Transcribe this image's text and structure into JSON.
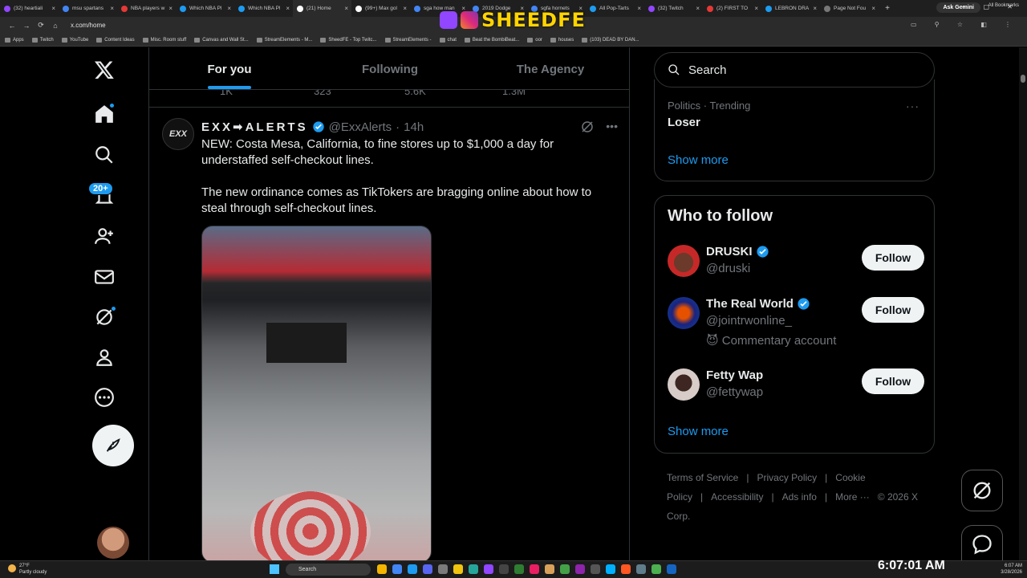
{
  "browser": {
    "tabs": [
      {
        "label": "(32) heartiali",
        "color": "#9146ff"
      },
      {
        "label": "msu spartans",
        "color": "#4285f4"
      },
      {
        "label": "NBA players w",
        "color": "#e53935"
      },
      {
        "label": "Which NBA Pl",
        "color": "#1d9bf0"
      },
      {
        "label": "Which NBA Pl",
        "color": "#1d9bf0"
      },
      {
        "label": "(21) Home",
        "color": "#ffffff"
      },
      {
        "label": "(99+) Max gol",
        "color": "#ffffff"
      },
      {
        "label": "sga how man",
        "color": "#4285f4"
      },
      {
        "label": "2019 Dodge",
        "color": "#4285f4"
      },
      {
        "label": "sgfa hornets",
        "color": "#4285f4"
      },
      {
        "label": "All Pop-Tarts",
        "color": "#1d9bf0"
      },
      {
        "label": "(32) Twitch",
        "color": "#9146ff"
      },
      {
        "label": "(2) FIRST TO",
        "color": "#e53935"
      },
      {
        "label": "LEBRON DRA",
        "color": "#1d9bf0"
      },
      {
        "label": "Page Not Fou",
        "color": "#777777"
      }
    ],
    "active_tab_index": 5,
    "new_tab": "+",
    "gemini": "Ask Gemini",
    "url": "x.com/home",
    "bookmarks": [
      "Apps",
      "Twitch",
      "YouTube",
      "Content Ideas",
      "Misc. Room stuff",
      "Canvas and Wall St...",
      "StreamElements - M...",
      "SheedFE - Top Twitc...",
      "StreamElements -",
      "chat",
      "Beat the BombiBeat...",
      "oor",
      "houses",
      "(103) DEAD BY DAN..."
    ],
    "all_bookmarks": "All Bookmarks"
  },
  "overlay": {
    "text": "SHEEDFE"
  },
  "x": {
    "tabs": [
      "For you",
      "Following",
      "The Agency"
    ],
    "selected_tab": 0,
    "prev_actions": [
      "1K",
      "323",
      "5.6K",
      "1.3M"
    ],
    "tweet": {
      "avatar_text": "EXX",
      "name": "EXX➡ALERTS",
      "handle": "@ExxAlerts",
      "time": "14h",
      "paragraphs": [
        "NEW: Costa Mesa, California, to fine stores up to $1,000 a day for understaffed self-checkout lines.",
        "The new ordinance comes as TikTokers are bragging online about how to steal through self-checkout lines."
      ]
    },
    "notifications_badge": "20+",
    "search_placeholder": "Search",
    "trend": {
      "category": "Politics · Trending",
      "name": "Loser",
      "more": "···"
    },
    "show_more": "Show more",
    "who_to_follow": {
      "title": "Who to follow",
      "users": [
        {
          "name": "DRUSKI",
          "handle": "@druski",
          "note": "",
          "button": "Follow",
          "verified": true
        },
        {
          "name": "The Real World",
          "handle": "@jointrwonline_",
          "note": "😈 Commentary account",
          "button": "Follow",
          "verified": true
        },
        {
          "name": "Fetty Wap",
          "handle": "@fettywap",
          "note": "",
          "button": "Follow",
          "verified": false
        }
      ]
    },
    "footer": [
      "Terms of Service",
      "|",
      "Privacy Policy",
      "|",
      "Cookie Policy",
      "|",
      "Accessibility",
      "|",
      "Ads info",
      "|",
      "More ···",
      "© 2026 X Corp."
    ]
  },
  "taskbar": {
    "weather_temp": "27°F",
    "weather_desc": "Partly cloudy",
    "search": "Search",
    "clock_big": "6:07:01 AM",
    "clock_time": "6:07 AM",
    "clock_date": "3/28/2026",
    "app_colors": [
      "#f4b400",
      "#4285f4",
      "#1d9bf0",
      "#5865f2",
      "#7b7b7b",
      "#f1c40f",
      "#26a69a",
      "#9146ff",
      "#444444",
      "#2e7d32",
      "#e91e63",
      "#d9a05b",
      "#43a047",
      "#8e24aa",
      "#555555",
      "#00b0ff",
      "#ff5722",
      "#607d8b",
      "#4caf50",
      "#1565c0"
    ]
  }
}
